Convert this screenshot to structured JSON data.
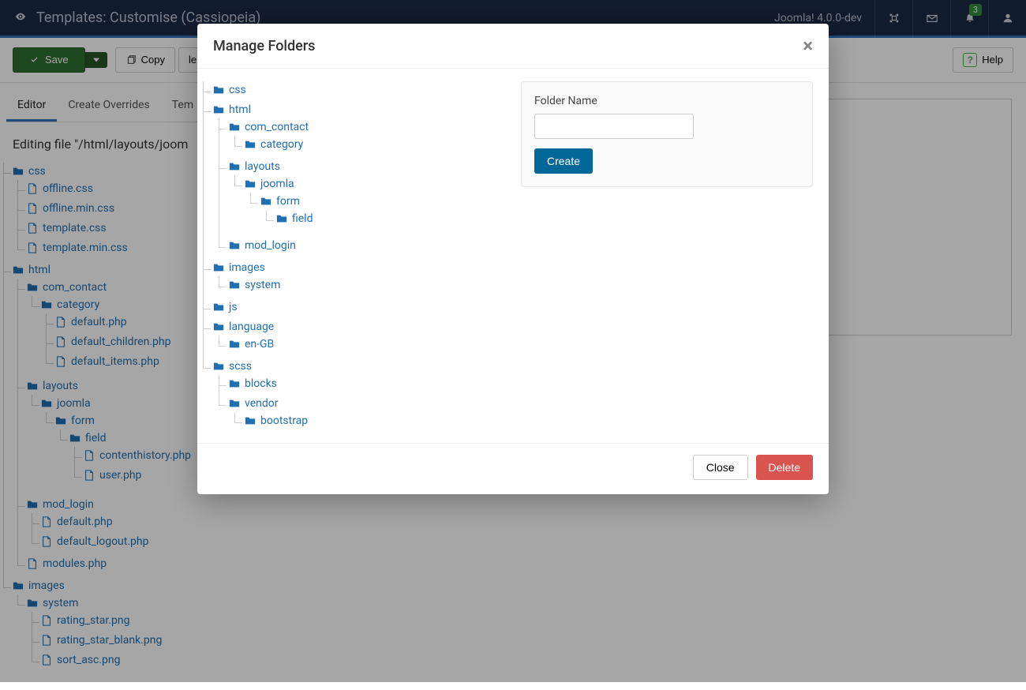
{
  "header": {
    "title": "Templates: Customise (Cassiopeia)",
    "version": "Joomla! 4.0.0-dev",
    "notifications_count": "3"
  },
  "toolbar": {
    "save": "Save",
    "copy": "Copy",
    "file": "le",
    "help": "Help"
  },
  "tabs": [
    "Editor",
    "Create Overrides",
    "Tem"
  ],
  "editing_label": "Editing file \"/html/layouts/joom",
  "sidebar_tree": [
    {
      "type": "folder",
      "label": "css",
      "children": [
        {
          "type": "file",
          "label": "offline.css"
        },
        {
          "type": "file",
          "label": "offline.min.css"
        },
        {
          "type": "file",
          "label": "template.css"
        },
        {
          "type": "file",
          "label": "template.min.css"
        }
      ]
    },
    {
      "type": "folder",
      "label": "html",
      "children": [
        {
          "type": "folder",
          "label": "com_contact",
          "children": [
            {
              "type": "folder",
              "label": "category",
              "children": [
                {
                  "type": "file",
                  "label": "default.php"
                },
                {
                  "type": "file",
                  "label": "default_children.php"
                },
                {
                  "type": "file",
                  "label": "default_items.php"
                }
              ]
            }
          ]
        },
        {
          "type": "folder",
          "label": "layouts",
          "children": [
            {
              "type": "folder",
              "label": "joomla",
              "children": [
                {
                  "type": "folder",
                  "label": "form",
                  "children": [
                    {
                      "type": "folder",
                      "label": "field",
                      "children": [
                        {
                          "type": "file",
                          "label": "contenthistory.php"
                        },
                        {
                          "type": "file",
                          "label": "user.php"
                        }
                      ]
                    }
                  ]
                }
              ]
            }
          ]
        },
        {
          "type": "folder",
          "label": "mod_login",
          "children": [
            {
              "type": "file",
              "label": "default.php"
            },
            {
              "type": "file",
              "label": "default_logout.php"
            }
          ]
        },
        {
          "type": "file",
          "label": "modules.php"
        }
      ]
    },
    {
      "type": "folder",
      "label": "images",
      "children": [
        {
          "type": "folder",
          "label": "system",
          "children": [
            {
              "type": "file",
              "label": "rating_star.png"
            },
            {
              "type": "file",
              "label": "rating_star_blank.png"
            },
            {
              "type": "file",
              "label": "sort_asc.png"
            }
          ]
        }
      ]
    }
  ],
  "modal": {
    "title": "Manage Folders",
    "form": {
      "label": "Folder Name",
      "create": "Create"
    },
    "footer": {
      "close": "Close",
      "delete": "Delete"
    },
    "tree": [
      {
        "label": "css"
      },
      {
        "label": "html",
        "children": [
          {
            "label": "com_contact",
            "children": [
              {
                "label": "category"
              }
            ]
          },
          {
            "label": "layouts",
            "children": [
              {
                "label": "joomla",
                "children": [
                  {
                    "label": "form",
                    "children": [
                      {
                        "label": "field"
                      }
                    ]
                  }
                ]
              }
            ]
          },
          {
            "label": "mod_login"
          }
        ]
      },
      {
        "label": "images",
        "children": [
          {
            "label": "system"
          }
        ]
      },
      {
        "label": "js"
      },
      {
        "label": "language",
        "children": [
          {
            "label": "en-GB"
          }
        ]
      },
      {
        "label": "scss",
        "children": [
          {
            "label": "blocks"
          },
          {
            "label": "vendor",
            "children": [
              {
                "label": "bootstrap"
              }
            ]
          }
        ]
      }
    ]
  }
}
